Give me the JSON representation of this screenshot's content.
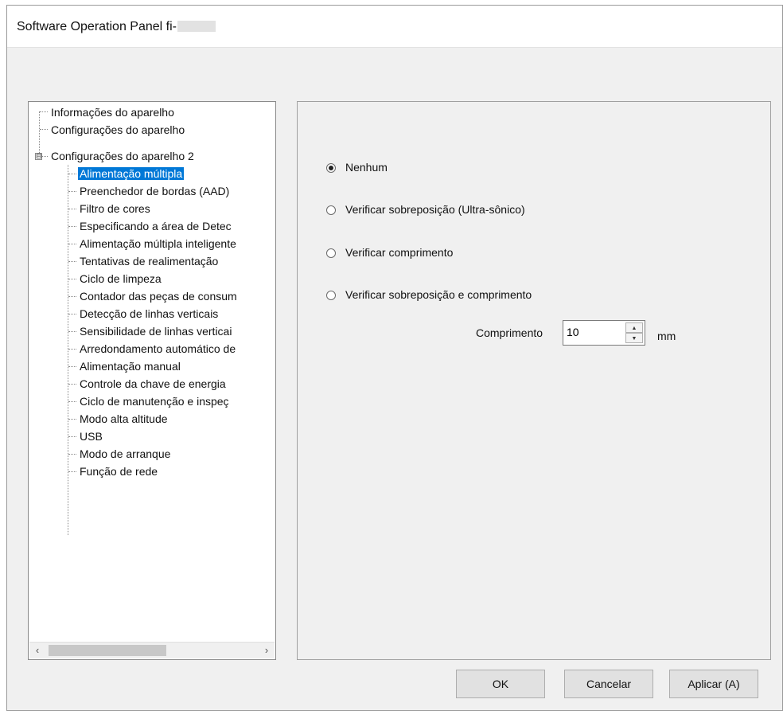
{
  "window": {
    "title": "Software Operation Panel fi-"
  },
  "tree": {
    "items": [
      {
        "label": "Informações do aparelho"
      },
      {
        "label": "Configurações do aparelho"
      },
      {
        "label": "Configurações do aparelho 2",
        "expanded": true,
        "expander": "⊟"
      },
      {
        "label": "Alimentação múltipla",
        "selected": true
      },
      {
        "label": "Preenchedor de bordas (AAD)"
      },
      {
        "label": "Filtro de cores"
      },
      {
        "label": "Especificando a área de Detec"
      },
      {
        "label": "Alimentação múltipla inteligente"
      },
      {
        "label": "Tentativas de realimentação"
      },
      {
        "label": "Ciclo de limpeza"
      },
      {
        "label": "Contador das peças de consum"
      },
      {
        "label": "Detecção de linhas verticais"
      },
      {
        "label": "Sensibilidade de linhas verticai"
      },
      {
        "label": "Arredondamento automático de"
      },
      {
        "label": "Alimentação manual"
      },
      {
        "label": "Controle da chave de energia"
      },
      {
        "label": "Ciclo de manutenção e inspeç"
      },
      {
        "label": "Modo alta altitude"
      },
      {
        "label": "USB"
      },
      {
        "label": "Modo de arranque"
      },
      {
        "label": "Função de rede"
      }
    ],
    "scroll_left": "‹",
    "scroll_right": "›"
  },
  "options": {
    "radios": [
      {
        "label": "Nenhum",
        "checked": true
      },
      {
        "label": "Verificar sobreposição (Ultra-sônico)",
        "checked": false
      },
      {
        "label": "Verificar comprimento",
        "checked": false
      },
      {
        "label": "Verificar sobreposição e comprimento",
        "checked": false
      }
    ],
    "length_label": "Comprimento",
    "length_value": "10",
    "unit": "mm",
    "spin_up": "▲",
    "spin_down": "▼"
  },
  "buttons": {
    "ok": "OK",
    "cancel": "Cancelar",
    "apply": "Aplicar (A)"
  }
}
